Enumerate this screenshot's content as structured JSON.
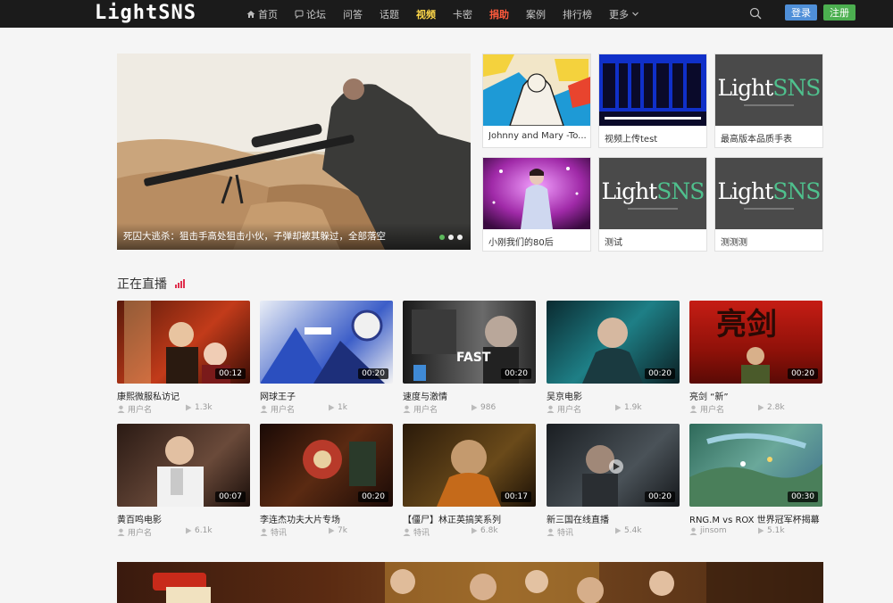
{
  "nav": {
    "logo": "LightSNS",
    "items": [
      {
        "label": "首页",
        "icon": "home-icon"
      },
      {
        "label": "论坛",
        "icon": "chat-icon"
      },
      {
        "label": "问答"
      },
      {
        "label": "话题"
      },
      {
        "label": "视频",
        "state": "active"
      },
      {
        "label": "卡密"
      },
      {
        "label": "捐助",
        "state": "hot"
      },
      {
        "label": "案例"
      },
      {
        "label": "排行榜"
      },
      {
        "label": "更多",
        "icon": "chevron-down-icon"
      }
    ],
    "login": "登录",
    "register": "注册"
  },
  "hero": {
    "title": "死囚大逃杀：狙击手高处狙击小伙，子弹却被其躲过，全部落空",
    "slides": 3,
    "active_slide": 1
  },
  "side_cards": [
    {
      "label": "Johnny and Mary -To..."
    },
    {
      "label": "视频上传test"
    },
    {
      "label": "最高版本品质手表"
    },
    {
      "label": "小刚我们的80后"
    },
    {
      "label": "测试"
    },
    {
      "label": "测测测"
    }
  ],
  "live_section": {
    "title": "正在直播"
  },
  "videos": [
    {
      "title": "康熙微服私访记",
      "duration": "00:12",
      "user": "用户名",
      "views": "1.3k"
    },
    {
      "title": "网球王子",
      "duration": "00:20",
      "user": "用户名",
      "views": "1k"
    },
    {
      "title": "速度与激情",
      "duration": "00:20",
      "user": "用户名",
      "views": "986"
    },
    {
      "title": "吴京电影",
      "duration": "00:20",
      "user": "用户名",
      "views": "1.9k"
    },
    {
      "title": "亮剑 “新”",
      "duration": "00:20",
      "user": "用户名",
      "views": "2.8k"
    },
    {
      "title": "黄百鸣电影",
      "duration": "00:07",
      "user": "用户名",
      "views": "6.1k"
    },
    {
      "title": "李连杰功夫大片专场",
      "duration": "00:20",
      "user": "特讯",
      "views": "7k"
    },
    {
      "title": "【僵尸】林正英搞笑系列",
      "duration": "00:17",
      "user": "特讯",
      "views": "6.8k"
    },
    {
      "title": "新三国在线直播",
      "duration": "00:20",
      "user": "特讯",
      "views": "5.4k"
    },
    {
      "title": "RNG.M vs ROX 世界冠军杯揭幕",
      "duration": "00:30",
      "user": "jinsom",
      "views": "5.1k"
    }
  ],
  "colors": {
    "nav_bg": "#1b1b1b",
    "active": "#ffd84a",
    "hot": "#ff5a3c",
    "login": "#4f8fd8",
    "register": "#4caf50",
    "live_icon": "#e0304e"
  }
}
